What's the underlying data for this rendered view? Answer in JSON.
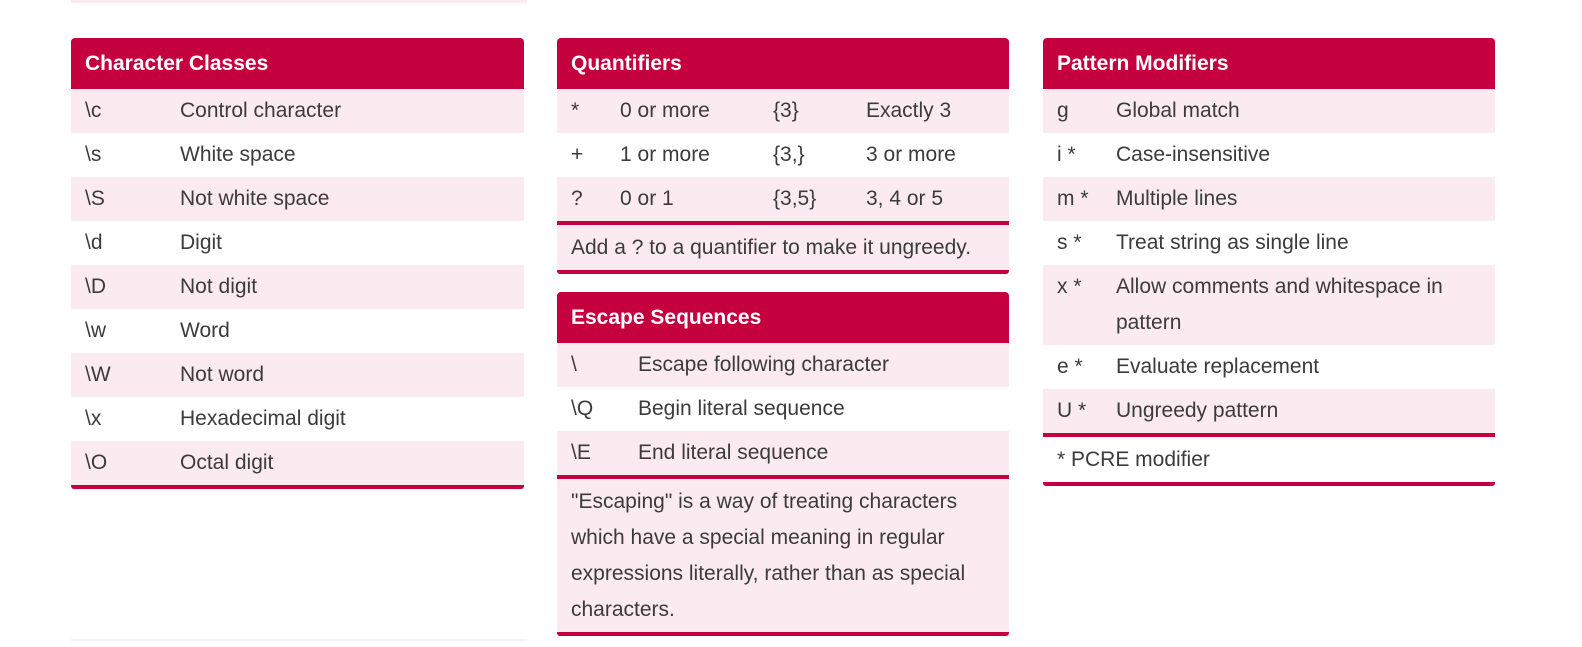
{
  "character_classes": {
    "title": "Character Classes",
    "rows": [
      {
        "code": "\\c",
        "desc": "Control character"
      },
      {
        "code": "\\s",
        "desc": "White space"
      },
      {
        "code": "\\S",
        "desc": "Not white space"
      },
      {
        "code": "\\d",
        "desc": "Digit"
      },
      {
        "code": "\\D",
        "desc": "Not digit"
      },
      {
        "code": "\\w",
        "desc": "Word"
      },
      {
        "code": "\\W",
        "desc": "Not word"
      },
      {
        "code": "\\x",
        "desc": "Hexadecimal digit"
      },
      {
        "code": "\\O",
        "desc": "Octal digit"
      }
    ]
  },
  "quantifiers": {
    "title": "Quantifiers",
    "rows": [
      {
        "sym1": "*",
        "desc1": "0 or more",
        "sym2": "{3}",
        "desc2": "Exactly 3"
      },
      {
        "sym1": "+",
        "desc1": "1 or more",
        "sym2": "{3,}",
        "desc2": "3 or more"
      },
      {
        "sym1": "?",
        "desc1": "0 or 1",
        "sym2": "{3,5}",
        "desc2": "3, 4 or 5"
      }
    ],
    "note": "Add a ? to a quantifier to make it ungreedy."
  },
  "escape_sequences": {
    "title": "Escape Sequences",
    "rows": [
      {
        "code": "\\",
        "desc": "Escape following character"
      },
      {
        "code": "\\Q",
        "desc": "Begin literal sequence"
      },
      {
        "code": "\\E",
        "desc": "End literal sequence"
      }
    ],
    "note": "\"Escaping\" is a way of treating characters which have a special meaning in regular expressions literally, rather than as special characters."
  },
  "pattern_modifiers": {
    "title": "Pattern Modifiers",
    "rows": [
      {
        "code": "g",
        "desc": "Global match"
      },
      {
        "code": "i *",
        "desc": "Case-insensitive"
      },
      {
        "code": "m *",
        "desc": "Multiple lines"
      },
      {
        "code": "s *",
        "desc": "Treat string as single line"
      },
      {
        "code": "x *",
        "desc": "Allow comments and whitespace in pattern"
      },
      {
        "code": "e *",
        "desc": "Evaluate replacement"
      },
      {
        "code": "U *",
        "desc": "Ungreedy pattern"
      }
    ],
    "note": "* PCRE modifier"
  }
}
